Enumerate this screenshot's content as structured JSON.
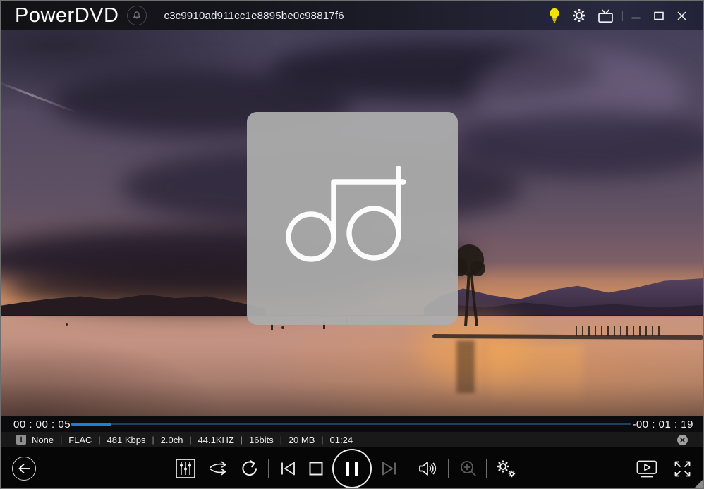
{
  "app": {
    "name": "PowerDVD",
    "window_title": "c3c9910ad911cc1e8895be0c98817f6"
  },
  "titlebar": {
    "icons": [
      "bell-icon",
      "lightbulb-icon",
      "gear-icon",
      "tv-mode-icon",
      "minimize-icon",
      "maximize-icon",
      "close-icon"
    ]
  },
  "media": {
    "placeholder_icon": "music-note-icon",
    "scene": "sunset-lake-photo"
  },
  "progress": {
    "elapsed": "00 : 00 : 05",
    "remaining": "-00 : 01 : 19",
    "percent_complete": 7.2
  },
  "info_bar": {
    "separator": "|",
    "items": [
      "None",
      "FLAC",
      "481 Kbps",
      "2.0ch",
      "44.1KHZ",
      "16bits",
      "20 MB",
      "01:24"
    ]
  },
  "controls": {
    "buttons": [
      "back",
      "equalizer",
      "shuffle",
      "repeat",
      "previous",
      "stop",
      "pause",
      "next",
      "volume",
      "zoom",
      "player-settings",
      "play-in-media-panel",
      "fullscreen",
      "resize-grip"
    ],
    "disabled": [
      "next",
      "zoom"
    ]
  },
  "colors": {
    "accent_blue": "#1e7ed6",
    "track_blue": "#1c3e63",
    "bulb_yellow": "#f2e206",
    "info_bar_bg": "#191919",
    "controls_bg": "#060606",
    "progress_row_bg": "#0b0b0d"
  }
}
